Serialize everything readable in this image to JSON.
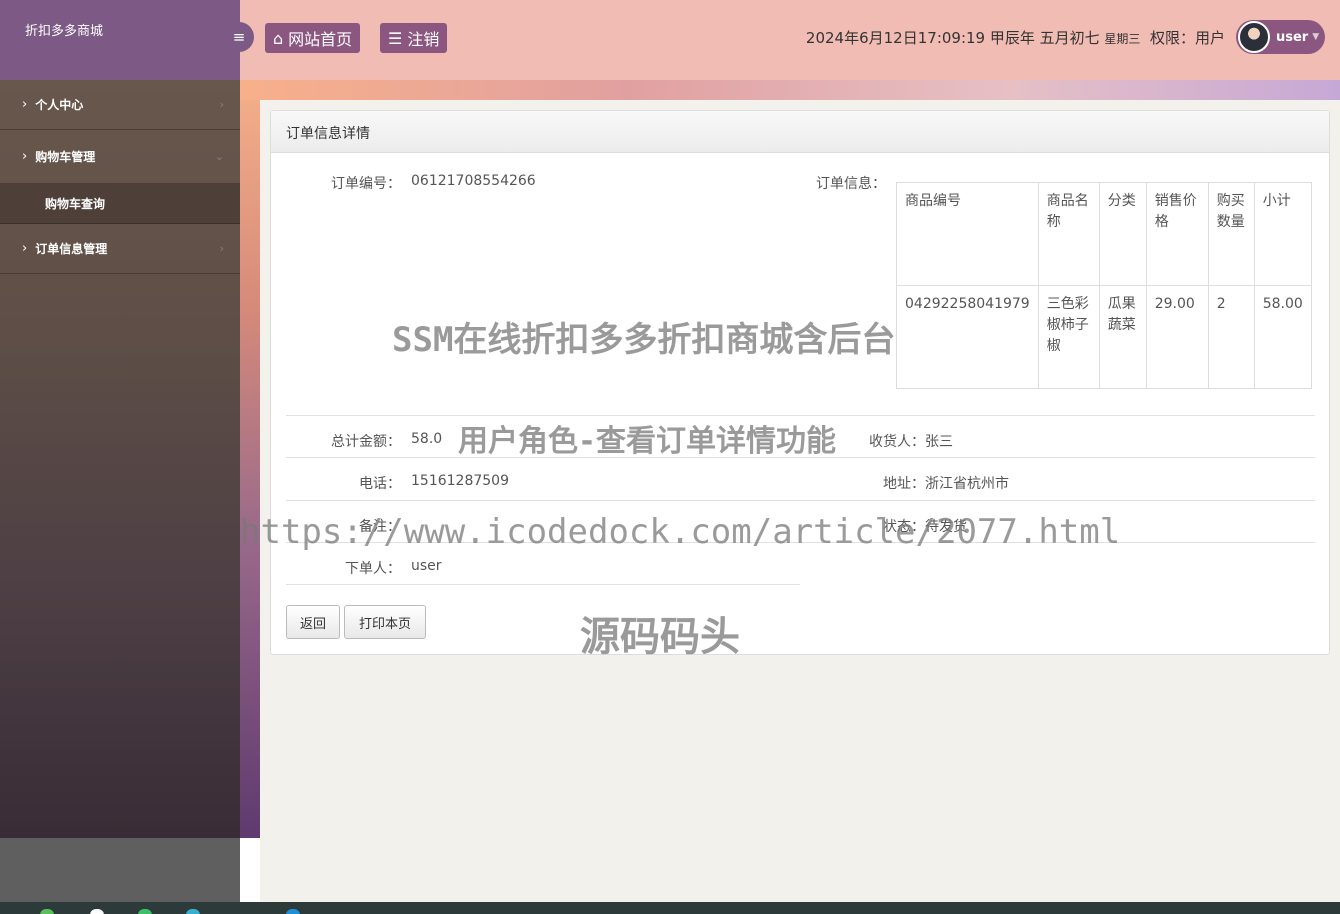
{
  "sidebar": {
    "brand": "折扣多多商城",
    "toggle_icon": "menu-icon",
    "items": [
      {
        "label": "个人中心"
      },
      {
        "label": "购物车管理",
        "submenu": [
          "购物车查询"
        ]
      },
      {
        "label": "订单信息管理"
      }
    ]
  },
  "header": {
    "home_label": "网站首页",
    "logout_label": "注销",
    "datetime": "2024年6月12日17:09:19 甲辰年 五月初七",
    "weekday": "星期三",
    "permission": "权限：用户",
    "username": "user"
  },
  "panel": {
    "title": "订单信息详情",
    "order_no_label": "订单编号：",
    "order_no": "06121708554266",
    "order_info_label": "订单信息：",
    "table": {
      "headers": [
        "商品编号",
        "商品名称",
        "分类",
        "销售价格",
        "购买数量",
        "小计"
      ],
      "rows": [
        [
          "04292258041979",
          "三色彩椒柿子椒",
          "瓜果蔬菜",
          "29.00",
          "2",
          "58.00"
        ]
      ]
    },
    "total_label": "总计金额：",
    "total": "58.0",
    "receiver_label": "收货人：",
    "receiver": "张三",
    "phone_label": "电话：",
    "phone": "15161287509",
    "address_label": "地址：",
    "address": "浙江省杭州市",
    "remark_label": "备注：",
    "remark": "",
    "status_label": "状态：",
    "status": "待发货",
    "orderer_label": "下单人：",
    "orderer": "user",
    "back_button": "返回",
    "print_button": "打印本页"
  },
  "watermarks": {
    "line1": "SSM在线折扣多多折扣商城含后台",
    "line2": "用户角色-查看订单详情功能",
    "line3": "https://www.icodedock.com/article/2077.html",
    "line4": "源码码头"
  }
}
